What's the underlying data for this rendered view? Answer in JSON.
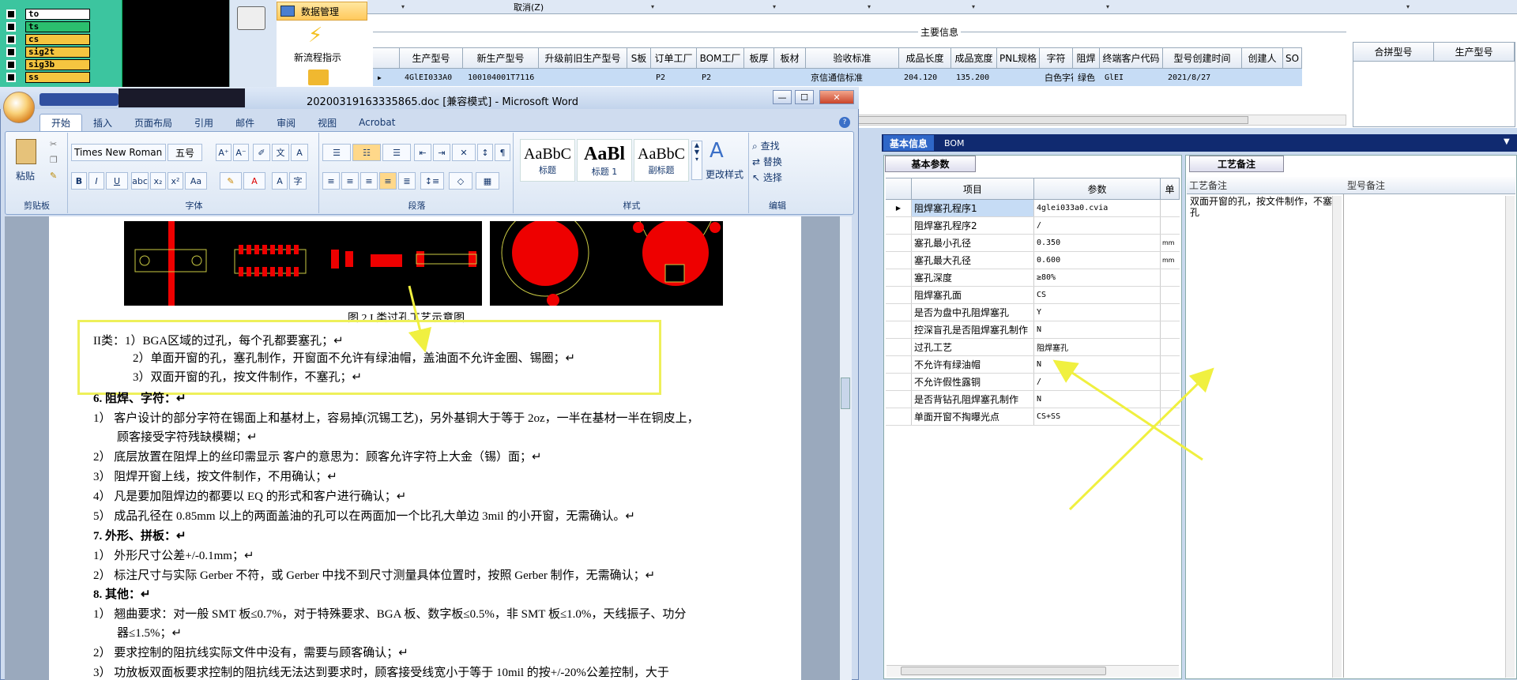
{
  "layers": [
    "to",
    "ts",
    "cs",
    "sig2t",
    "sig3b",
    "ss"
  ],
  "layer_colors": [
    "#ffffff",
    "#2bbf6e",
    "#f5c540",
    "#f5c540",
    "#f5c540",
    "#f5c540"
  ],
  "nav": {
    "data_mgmt": "数据管理",
    "new_flow": "新流程指示"
  },
  "main_grid": {
    "cancel": "取消(Z)",
    "caption": "主要信息",
    "headers": [
      "生产型号",
      "新生产型号",
      "升级前旧生产型号",
      "S板",
      "订单工厂",
      "BOM工厂",
      "板厚",
      "板材",
      "验收标准",
      "成品长度",
      "成品宽度",
      "PNL规格",
      "字符",
      "阻焊",
      "终端客户代码",
      "型号创建时间",
      "创建人",
      "SO"
    ],
    "row": [
      "4GlEI033A0",
      "100104001T7116",
      "",
      "",
      "P2",
      "P2",
      "",
      "",
      "京信通信标准",
      "204.120",
      "135.200",
      "",
      "白色字符",
      "绿色",
      "GlEI",
      "2021/8/27",
      "",
      ""
    ]
  },
  "right_grid": {
    "headers": [
      "合拼型号",
      "生产型号"
    ]
  },
  "tabs": {
    "basic": "基本信息",
    "bom": "BOM"
  },
  "params": {
    "tab": "基本参数",
    "headers": [
      "项目",
      "参数",
      "单"
    ],
    "rows": [
      {
        "name": "阻焊塞孔程序1",
        "value": "4glei033a0.cvia",
        "unit": ""
      },
      {
        "name": "阻焊塞孔程序2",
        "value": "/",
        "unit": ""
      },
      {
        "name": "塞孔最小孔径",
        "value": "0.350",
        "unit": "mm"
      },
      {
        "name": "塞孔最大孔径",
        "value": "0.600",
        "unit": "mm"
      },
      {
        "name": "塞孔深度",
        "value": "≥80%",
        "unit": ""
      },
      {
        "name": "阻焊塞孔面",
        "value": "CS",
        "unit": ""
      },
      {
        "name": "是否为盘中孔阻焊塞孔",
        "value": "Y",
        "unit": ""
      },
      {
        "name": "控深盲孔是否阻焊塞孔制作",
        "value": "N",
        "unit": ""
      },
      {
        "name": "过孔工艺",
        "value": "阻焊塞孔",
        "unit": ""
      },
      {
        "name": "不允许有绿油帽",
        "value": "N",
        "unit": ""
      },
      {
        "name": "不允许假性露铜",
        "value": "/",
        "unit": ""
      },
      {
        "name": "是否背钻孔阻焊塞孔制作",
        "value": "N",
        "unit": ""
      },
      {
        "name": "单面开窗不掏曝光点",
        "value": "CS+SS",
        "unit": ""
      }
    ]
  },
  "remarks": {
    "tab": "工艺备注",
    "col1": "工艺备注",
    "col2": "型号备注",
    "text": "双面开窗的孔，按文件制作，不塞孔"
  },
  "word": {
    "title": "20200319163335865.doc [兼容模式] - Microsoft Word",
    "ribbon_tabs": [
      "开始",
      "插入",
      "页面布局",
      "引用",
      "邮件",
      "审阅",
      "视图",
      "Acrobat"
    ],
    "font": "Times New Roman",
    "size": "五号",
    "groups": {
      "clipboard": "剪贴板",
      "font": "字体",
      "paragraph": "段落",
      "styles": "样式",
      "editing": "编辑"
    },
    "paste": "粘贴",
    "styles": [
      {
        "preview": "AaBbC",
        "name": "标题"
      },
      {
        "preview": "AaBl",
        "name": "标题 1"
      },
      {
        "preview": "AaBbC",
        "name": "副标题"
      }
    ],
    "change_styles": "更改样式",
    "find": "查找",
    "replace": "替换",
    "select": "选择",
    "figcap": "图 2   I 类过孔工艺示意图",
    "lines": [
      "II类：1）BGA区域的过孔，每个孔都要塞孔；↵",
      "2）单面开窗的孔，塞孔制作，开窗面不允许有绿油帽，盖油面不允许金圈、锡圈；↵",
      "3）双面开窗的孔，按文件制作，不塞孔；↵",
      "6.   阻焊、字符：↵",
      "1） 客户设计的部分字符在锡面上和基材上，容易掉(沉锡工艺)，另外基铜大于等于 2oz，一半在基材一半在铜皮上，",
      "顾客接受字符残缺模糊；↵",
      "2） 底层放置在阻焊上的丝印需显示 客户的意思为：顾客允许字符上大金（锡）面；↵",
      "3） 阻焊开窗上线，按文件制作，不用确认；↵",
      "4） 凡是要加阻焊边的都要以 EQ 的形式和客户进行确认；↵",
      "5） 成品孔径在 0.85mm 以上的两面盖油的孔可以在两面加一个比孔大单边 3mil 的小开窗，无需确认。↵",
      "7.   外形、拼板：↵",
      "1） 外形尺寸公差+/-0.1mm；↵",
      "2） 标注尺寸与实际 Gerber 不符，或 Gerber 中找不到尺寸测量具体位置时，按照 Gerber 制作，无需确认；↵",
      "8.   其他：↵",
      "1） 翘曲要求：对一般 SMT 板≤0.7%，对于特殊要求、BGA 板、数字板≤0.5%，非 SMT 板≤1.0%，天线振子、功分",
      "器≤1.5%；↵",
      "2） 要求控制的阻抗线实际文件中没有，需要与顾客确认；↵",
      "3） 功放板双面板要求控制的阻抗线无法达到要求时，顾客接受线宽小于等于  10mil  的按+/-20%公差控制，大于"
    ]
  }
}
